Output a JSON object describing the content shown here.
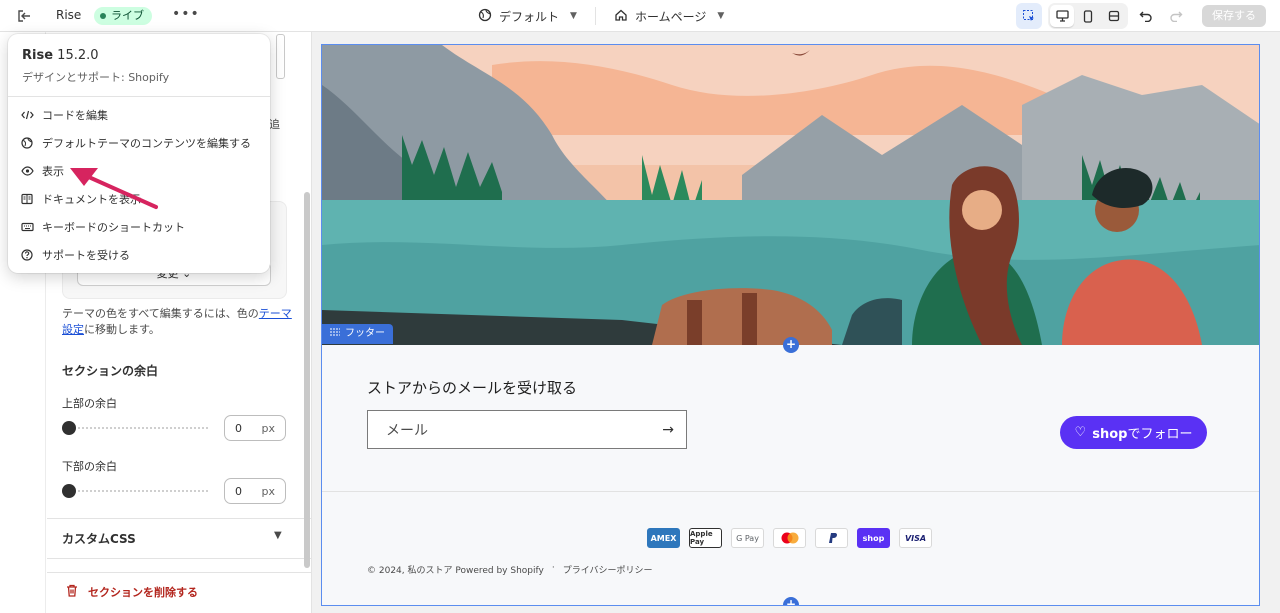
{
  "topbar": {
    "exit_icon": "exit-icon",
    "theme_name": "Rise",
    "live_badge": "ライブ",
    "more_label": "•••",
    "template_selector": "デフォルト",
    "page_selector": "ホームページ",
    "save_label": "保存する"
  },
  "menu": {
    "theme_name": "Rise",
    "theme_version": "15.2.0",
    "subtitle": "デザインとサポート: Shopify",
    "items": [
      {
        "label": "コードを編集",
        "icon": "code-icon"
      },
      {
        "label": "デフォルトテーマのコンテンツを編集する",
        "icon": "globe-icon"
      },
      {
        "label": "表示",
        "icon": "eye-icon"
      },
      {
        "label": "ドキュメントを表示",
        "icon": "book-icon"
      },
      {
        "label": "キーボードのショートカット",
        "icon": "keyboard-icon"
      },
      {
        "label": "サポートを受ける",
        "icon": "help-icon"
      }
    ]
  },
  "panel": {
    "extra_text": "追",
    "change_button": "変更",
    "desc_prefix": "テーマの色をすべて編集するには、色の",
    "desc_link": "テーマ設定",
    "desc_suffix": "に移動します。",
    "section_padding_title": "セクションの余白",
    "top_padding_label": "上部の余白",
    "top_padding_value": "0",
    "bottom_padding_label": "下部の余白",
    "bottom_padding_value": "0",
    "unit": "px",
    "custom_css": "カスタムCSS",
    "delete_section": "セクションを削除する"
  },
  "preview": {
    "footer_tag": "フッター",
    "newsletter_title": "ストアからのメールを受け取る",
    "email_placeholder": "メール",
    "shop_follow_prefix": "shop",
    "shop_follow_suffix": "でフォロー",
    "payments": [
      "AMEX",
      "Apple Pay",
      "G Pay",
      "Mastercard",
      "PayPal",
      "shop",
      "VISA"
    ],
    "copyright": "© 2024, 私のストア Powered by Shopify",
    "separator": "·",
    "privacy": "プライバシーポリシー"
  },
  "colors": {
    "accent_blue": "#3a6fd8",
    "shop_purple": "#5a31f4",
    "live_green": "#29845a",
    "annotation_arrow": "#d6245f",
    "delete_red": "#b3261e"
  }
}
